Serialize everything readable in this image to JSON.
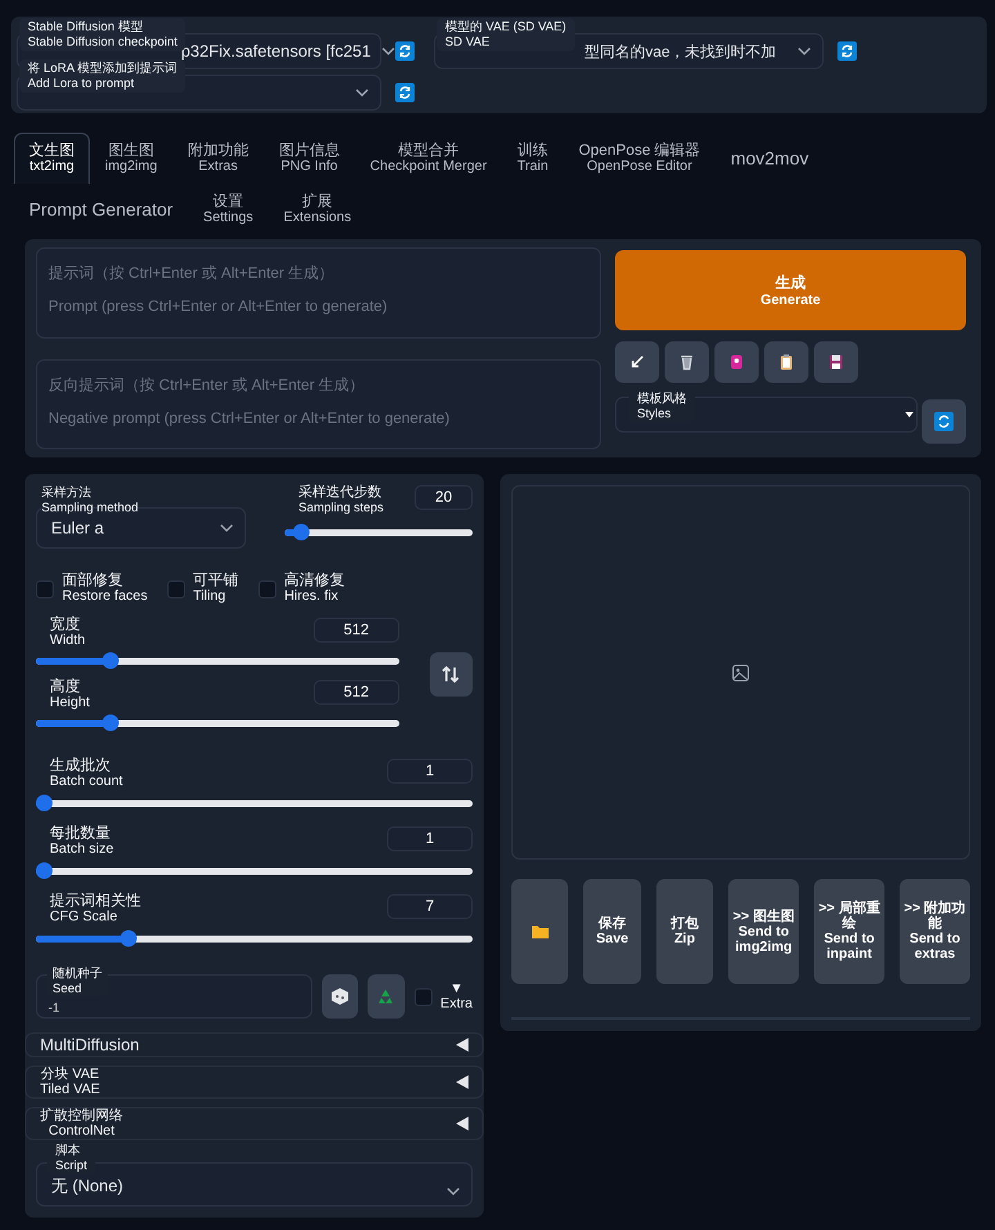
{
  "model_bar": {
    "checkpoint": {
      "label_zh": "Stable Diffusion 模型",
      "label_en": "Stable Diffusion checkpoint",
      "value": "p32Fix.safetensors [fc251"
    },
    "vae": {
      "label_zh": "模型的 VAE (SD VAE)",
      "label_en": "SD VAE",
      "value": "型同名的vae，未找到时不加"
    },
    "lora": {
      "label_zh": "将 LoRA 模型添加到提示词",
      "label_en": "Add Lora to prompt"
    }
  },
  "tabs": [
    {
      "zh": "文生图",
      "en": "txt2img",
      "selected": true
    },
    {
      "zh": "图生图",
      "en": "img2img",
      "selected": false
    },
    {
      "zh": "附加功能",
      "en": "Extras",
      "selected": false
    },
    {
      "zh": "图片信息",
      "en": "PNG Info",
      "selected": false
    },
    {
      "zh": "模型合并",
      "en": "Checkpoint Merger",
      "selected": false
    },
    {
      "zh": "训练",
      "en": "Train",
      "selected": false
    },
    {
      "zh": "OpenPose 编辑器",
      "en": "OpenPose Editor",
      "selected": false
    },
    {
      "zh": "mov2mov",
      "selected": false
    },
    {
      "zh": "Prompt Generator",
      "selected": false
    },
    {
      "zh": "设置",
      "en": "Settings",
      "selected": false
    },
    {
      "zh": "扩展",
      "en": "Extensions",
      "selected": false
    }
  ],
  "prompt": {
    "placeholder": "提示词（按 Ctrl+Enter 或 Alt+Enter 生成）\nPrompt (press Ctrl+Enter or Alt+Enter to generate)"
  },
  "negative_prompt": {
    "placeholder": "反向提示词（按 Ctrl+Enter 或 Alt+Enter 生成）\nNegative prompt (press Ctrl+Enter or Alt+Enter to generate)"
  },
  "generate": {
    "zh": "生成",
    "en": "Generate"
  },
  "styles": {
    "label_zh": "模板风格",
    "label_en": "Styles"
  },
  "sampling_method": {
    "label_zh": "采样方法",
    "label_en": "Sampling method",
    "value": "Euler a"
  },
  "sampling_steps": {
    "label_zh": "采样迭代步数",
    "label_en": "Sampling steps",
    "value": "20",
    "level": 0.13
  },
  "checkboxes": [
    {
      "zh": "面部修复",
      "en": "Restore faces",
      "checked": false
    },
    {
      "zh": "可平铺",
      "en": "Tiling",
      "checked": false
    },
    {
      "zh": "高清修复",
      "en": "Hires. fix",
      "checked": false
    }
  ],
  "size_sliders": [
    {
      "label_zh": "宽度",
      "label_en": "Width",
      "value": "512",
      "level": 0.23
    },
    {
      "label_zh": "高度",
      "label_en": "Height",
      "value": "512",
      "level": 0.23
    }
  ],
  "sliders": [
    {
      "label_zh": "生成批次",
      "label_en": "Batch count",
      "value": "1",
      "level": 0
    },
    {
      "label_zh": "每批数量",
      "label_en": "Batch size",
      "value": "1",
      "level": 0
    },
    {
      "label_zh": "提示词相关性",
      "label_en": "CFG Scale",
      "value": "7",
      "level": 0.23
    }
  ],
  "seed": {
    "label_zh": "随机种子",
    "label_en": "Seed",
    "value": "-1"
  },
  "extra": {
    "toggle": "▼",
    "label": "Extra",
    "checked": false
  },
  "accordions": [
    {
      "zh": "MultiDiffusion",
      "expanded": false
    },
    {
      "zh": "分块 VAE",
      "en": "Tiled VAE",
      "expanded": false
    },
    {
      "zh": "扩散控制网络",
      "en": "ControlNet",
      "expanded": false
    }
  ],
  "script": {
    "label_zh": "脚本",
    "label_en": "Script",
    "value": "无 (None)"
  },
  "output_buttons": [
    {
      "kind": "folder"
    },
    {
      "kind": "text",
      "zh": "保存",
      "en": "Save"
    },
    {
      "kind": "text",
      "zh": "打包",
      "en": "Zip"
    },
    {
      "kind": "text",
      "zh": ">> 图生图",
      "en": "Send to img2img"
    },
    {
      "kind": "text",
      "zh": ">> 局部重绘",
      "en": "Send to inpaint"
    },
    {
      "kind": "text",
      "zh": ">> 附加功能",
      "en": "Send to extras"
    }
  ]
}
